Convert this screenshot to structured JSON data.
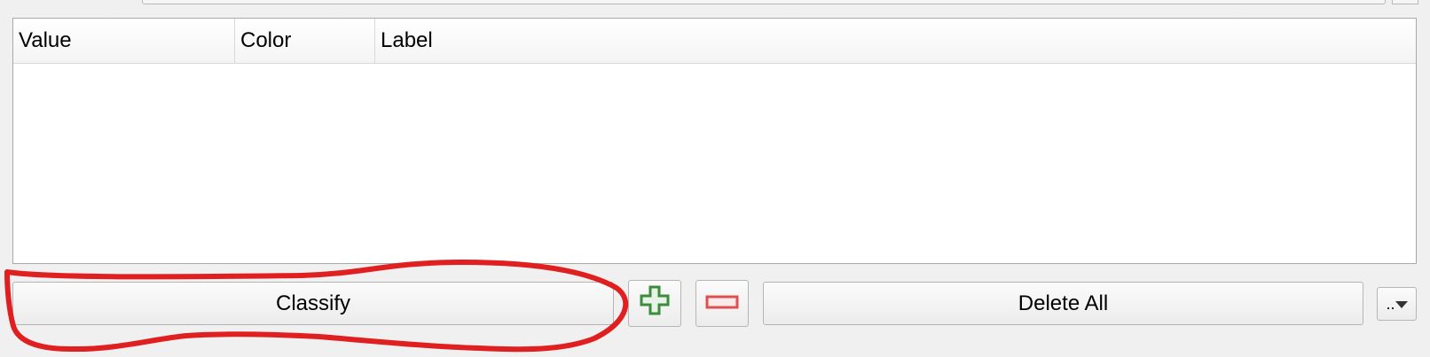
{
  "table": {
    "columns": [
      {
        "label": "Value"
      },
      {
        "label": "Color"
      },
      {
        "label": "Label"
      }
    ],
    "rows": []
  },
  "buttons": {
    "classify_label": "Classify",
    "delete_all_label": "Delete All",
    "more_label": ".."
  },
  "icons": {
    "add": "plus-icon",
    "remove": "minus-icon",
    "dropdown": "triangle-down-icon"
  },
  "colors": {
    "add_icon_green": "#3d8b3d",
    "remove_icon_red": "#e05050",
    "annotation_red": "#e02020"
  }
}
